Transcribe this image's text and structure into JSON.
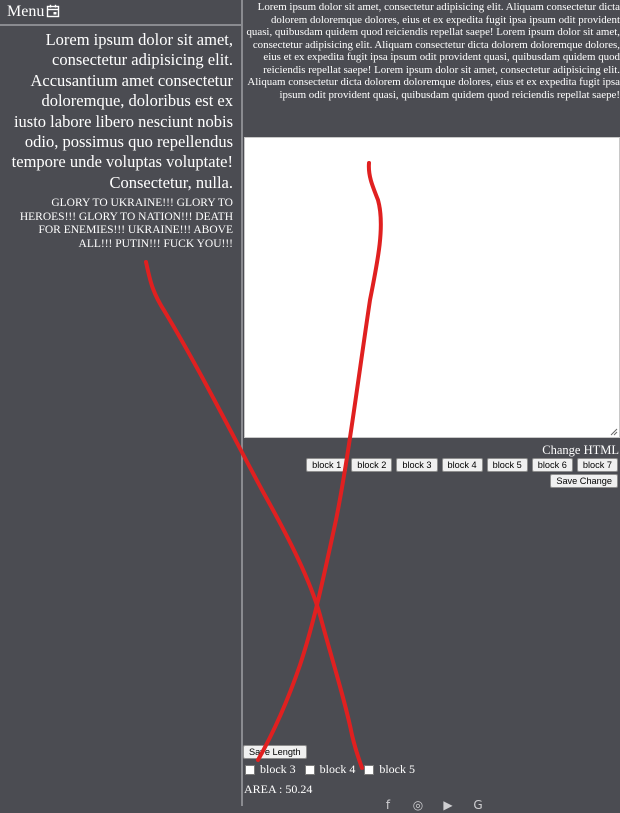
{
  "menu": {
    "label": "Menu",
    "icon": "calendar-icon"
  },
  "left": {
    "paragraph": "Lorem ipsum dolor sit amet, consectetur adipisicing elit. Accusantium amet consectetur doloremque, doloribus est ex iusto labore libero nesciunt nobis odio, possimus quo repellendus tempore unde voluptas voluptate! Consectetur, nulla.",
    "note": "GLORY TO UKRAINE!!! GLORY TO HEROES!!! GLORY TO NATION!!! DEATH FOR ENEMIES!!! UKRAINE!!! ABOVE ALL!!! PUTIN!!! FUCK YOU!!!"
  },
  "right": {
    "top_text": "Lorem ipsum dolor sit amet, consectetur adipisicing elit. Aliquam consectetur dicta dolorem doloremque dolores, eius et ex expedita fugit ipsa ipsum odit provident quasi, quibusdam quidem quod reiciendis repellat saepe! Lorem ipsum dolor sit amet, consectetur adipisicing elit. Aliquam consectetur dicta dolorem doloremque dolores, eius et ex expedita fugit ipsa ipsum odit provident quasi, quibusdam quidem quod reiciendis repellat saepe! Lorem ipsum dolor sit amet, consectetur adipisicing elit. Aliquam consectetur dicta dolorem doloremque dolores, eius et ex expedita fugit ipsa ipsum odit provident quasi, quibusdam quidem quod reiciendis repellat saepe!",
    "editor_value": "",
    "change_html_label": "Change HTML",
    "blocks": [
      "block 1",
      "block 2",
      "block 3",
      "block 4",
      "block 5",
      "block 6",
      "block 7"
    ],
    "save_change_label": "Save Change",
    "save_length_label": "Save Length",
    "checkboxes": [
      {
        "label": "block 3",
        "checked": false
      },
      {
        "label": "block 4",
        "checked": false
      },
      {
        "label": "block 5",
        "checked": false
      }
    ],
    "area_text": "AREA : 50.24",
    "social_icons": [
      "facebook-icon",
      "instagram-icon",
      "youtube-icon",
      "google-icon"
    ]
  },
  "colors": {
    "background": "#4b4c52",
    "divider": "#8a8b90",
    "scribble": "#e02020"
  }
}
